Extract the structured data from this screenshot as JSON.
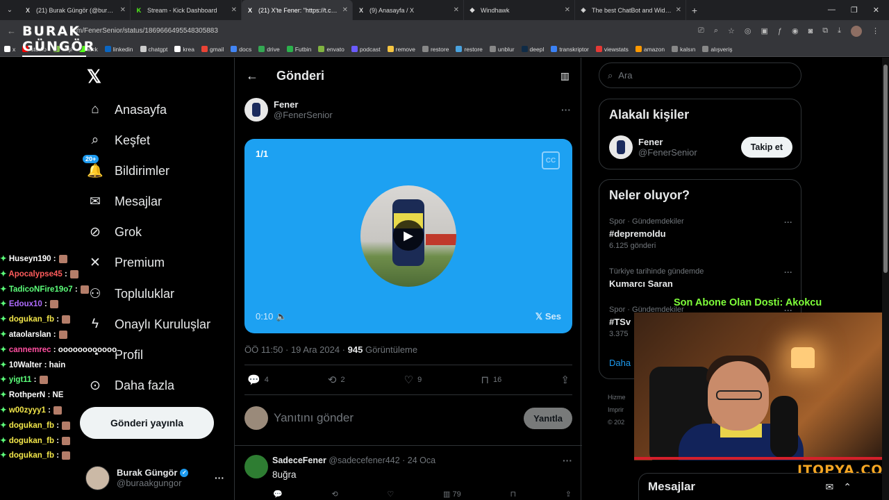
{
  "browser": {
    "tabs": [
      {
        "title": "(21) Burak Güngör (@buraakgungor)",
        "icon": "x-icon",
        "active": false
      },
      {
        "title": "Stream - Kick Dashboard",
        "icon": "kick-icon",
        "active": false
      },
      {
        "title": "(21) X'te Fener: \"https://t.co/ahzF\"",
        "icon": "x-icon",
        "active": true
      },
      {
        "title": "(9) Anasayfa / X",
        "icon": "x-icon",
        "active": false
      },
      {
        "title": "Windhawk",
        "icon": "windhawk-icon",
        "active": false
      },
      {
        "title": "The best ChatBot and Widgets",
        "icon": "diamond-icon",
        "active": false
      }
    ],
    "url": "m/FenerSenior/status/1869666495548305883",
    "bookmarks": [
      {
        "label": "x",
        "color": "#ffffff"
      },
      {
        "label": "studio",
        "color": "#ff0000"
      },
      {
        "label": "ekşi",
        "color": "#81c14b"
      },
      {
        "label": "kick",
        "color": "#53fc18"
      },
      {
        "label": "linkedin",
        "color": "#0a66c2"
      },
      {
        "label": "chatgpt",
        "color": "#cccccc"
      },
      {
        "label": "krea",
        "color": "#ffffff"
      },
      {
        "label": "gmail",
        "color": "#ea4335"
      },
      {
        "label": "docs",
        "color": "#4285f4"
      },
      {
        "label": "drive",
        "color": "#34a853"
      },
      {
        "label": "Futbin",
        "color": "#2bb24c"
      },
      {
        "label": "envato",
        "color": "#81b441"
      },
      {
        "label": "podcast",
        "color": "#6b5bff"
      },
      {
        "label": "remove",
        "color": "#f5c542"
      },
      {
        "label": "restore",
        "color": "#888888"
      },
      {
        "label": "restore",
        "color": "#4aa3df"
      },
      {
        "label": "unblur",
        "color": "#888888"
      },
      {
        "label": "deepl",
        "color": "#0f2b46"
      },
      {
        "label": "transkriptor",
        "color": "#3b82f6"
      },
      {
        "label": "viewstats",
        "color": "#e53935"
      },
      {
        "label": "amazon",
        "color": "#ff9900"
      },
      {
        "label": "kalsın",
        "color": "#888888"
      },
      {
        "label": "alışveriş",
        "color": "#888888"
      }
    ]
  },
  "overlay": {
    "logo_line1": "BURAK",
    "logo_line2": "GÜNGÖR",
    "latest_sub": "Son Abone Olan Dosti: Akokcu",
    "brand": "ITOPYA.COM"
  },
  "nav": {
    "items": [
      {
        "label": "Anasayfa",
        "icon": "home-icon",
        "glyph": "⌂"
      },
      {
        "label": "Keşfet",
        "icon": "search-icon",
        "glyph": "⌕"
      },
      {
        "label": "Bildirimler",
        "icon": "bell-icon",
        "glyph": "🔔"
      },
      {
        "label": "Mesajlar",
        "icon": "envelope-icon",
        "glyph": "✉"
      },
      {
        "label": "Grok",
        "icon": "grok-icon",
        "glyph": "⊘"
      },
      {
        "label": "Premium",
        "icon": "x-premium-icon",
        "glyph": "✕"
      },
      {
        "label": "Topluluklar",
        "icon": "people-icon",
        "glyph": "⚇"
      },
      {
        "label": "Onaylı Kuruluşlar",
        "icon": "lightning-icon",
        "glyph": "ϟ"
      },
      {
        "label": "Profil",
        "icon": "user-icon",
        "glyph": "◔"
      },
      {
        "label": "Daha fazla",
        "icon": "more-circle-icon",
        "glyph": "⊙"
      }
    ],
    "notif_badge": "20+",
    "post_button": "Gönderi yayınla",
    "account_name": "Burak Güngör",
    "account_handle": "@buraakgungor"
  },
  "chat": [
    {
      "user": "Huseyn190",
      "msg": ":",
      "color": "#ffffff"
    },
    {
      "user": "Apocalypse45",
      "msg": ":",
      "color": "#ff5c5c"
    },
    {
      "user": "TadicoNFire19o7",
      "msg": ":",
      "color": "#5cff7a"
    },
    {
      "user": "Edoux10",
      "msg": ":",
      "color": "#b06cff"
    },
    {
      "user": "dogukan_fb",
      "msg": ":",
      "color": "#f3e74a"
    },
    {
      "user": "ataolarslan",
      "msg": ":",
      "color": "#ffffff"
    },
    {
      "user": "cannemrec",
      "msg": ": oooooooooooo",
      "color": "#ff4fa0"
    },
    {
      "user": "10Walter",
      "msg": ": hain",
      "color": "#ffffff"
    },
    {
      "user": "yigt11",
      "msg": ":",
      "color": "#5cff7a"
    },
    {
      "user": "RothperN",
      "msg": ": NE",
      "color": "#ffffff"
    },
    {
      "user": "w00zyyy1",
      "msg": ":",
      "color": "#f3e74a"
    },
    {
      "user": "dogukan_fb",
      "msg": ":",
      "color": "#f3e74a"
    },
    {
      "user": "dogukan_fb",
      "msg": ":",
      "color": "#f3e74a"
    },
    {
      "user": "dogukan_fb",
      "msg": ":",
      "color": "#f3e74a"
    }
  ],
  "post": {
    "header_title": "Gönderi",
    "author_name": "Fener",
    "author_handle": "@FenerSenior",
    "media_counter": "1/1",
    "media_time": "0:10",
    "media_sound": "Ses",
    "timestamp": "ÖÖ 11:50 · 19 Ara 2024 ·",
    "views_count": "945",
    "views_label": "Görüntüleme",
    "replies": "4",
    "reposts": "2",
    "likes": "9",
    "bookmarks": "16",
    "reply_placeholder": "Yanıtını gönder",
    "reply_button": "Yanıtla"
  },
  "reply_tweet": {
    "name": "SadeceFener",
    "handle": "@sadecefener442",
    "date": "· 24 Oca",
    "text": "8uğra",
    "views": "79"
  },
  "sidebar": {
    "search_placeholder": "Ara",
    "related_title": "Alakalı kişiler",
    "related_name": "Fener",
    "related_handle": "@FenerSenior",
    "follow_button": "Takip et",
    "trends_title": "Neler oluyor?",
    "trends": [
      {
        "category": "Spor · Gündemdekiler",
        "title": "#depremoldu",
        "count": "6.125 gönderi"
      },
      {
        "category": "Türkiye tarihinde gündemde",
        "title": "Kumarcı Saran",
        "count": ""
      },
      {
        "category": "Spor · Gündemdekiler",
        "title": "#TSv",
        "count": "3.375"
      }
    ],
    "show_more": "Daha",
    "footer_1": "Hizme",
    "footer_2": "Imprir",
    "footer_3": "© 202"
  },
  "messages_bar": {
    "title": "Mesajlar"
  }
}
